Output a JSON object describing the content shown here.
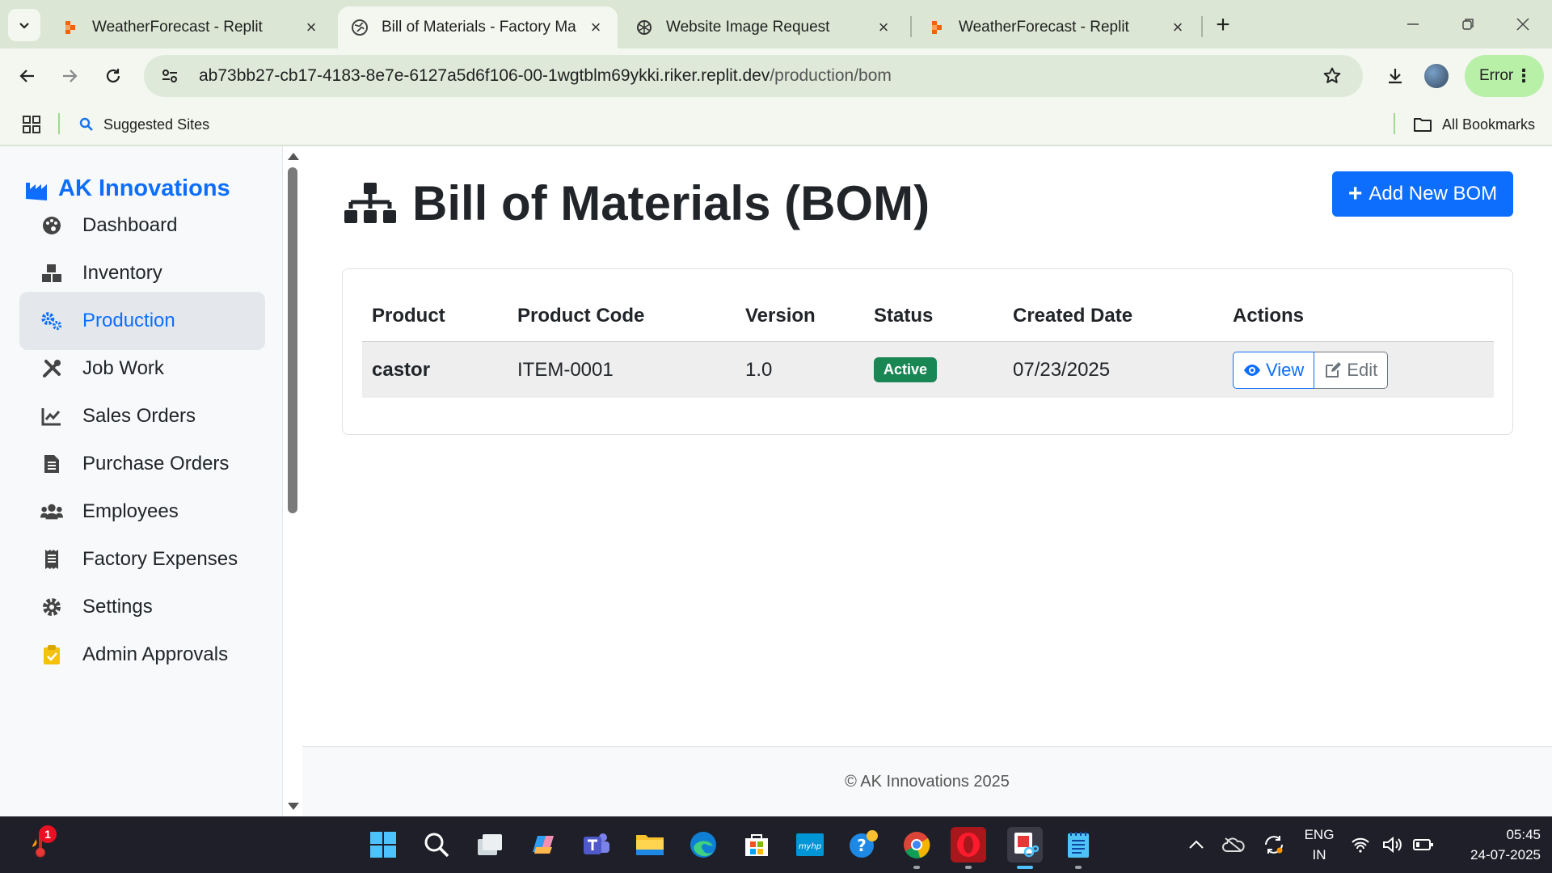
{
  "browser": {
    "tabs": [
      {
        "title": "WeatherForecast - Replit",
        "favicon": "replit-icon",
        "active": false
      },
      {
        "title": "Bill of Materials - Factory Mana",
        "favicon": "globe-icon",
        "active": true
      },
      {
        "title": "Website Image Request",
        "favicon": "chatgpt-icon",
        "active": false
      },
      {
        "title": "WeatherForecast - Replit",
        "favicon": "replit-icon",
        "active": false
      }
    ],
    "url_host": "ab73bb27-cb17-4183-8e7e-6127a5d6f106-00-1wgtblm69ykki.riker.replit.dev",
    "url_path": "/production/bom",
    "profile_status": "Error",
    "bookmarks": {
      "suggested": "Suggested Sites",
      "all": "All Bookmarks"
    }
  },
  "app": {
    "brand": "AK Innovations",
    "accent_color": "#0d6efd",
    "nav": [
      {
        "label": "Dashboard",
        "icon": "palette-icon",
        "active": false
      },
      {
        "label": "Inventory",
        "icon": "boxes-icon",
        "active": false
      },
      {
        "label": "Production",
        "icon": "cogs-icon",
        "active": true
      },
      {
        "label": "Job Work",
        "icon": "tools-icon",
        "active": false
      },
      {
        "label": "Sales Orders",
        "icon": "chart-line-icon",
        "active": false
      },
      {
        "label": "Purchase Orders",
        "icon": "file-invoice-icon",
        "active": false
      },
      {
        "label": "Employees",
        "icon": "users-icon",
        "active": false
      },
      {
        "label": "Factory Expenses",
        "icon": "receipt-icon",
        "active": false
      },
      {
        "label": "Settings",
        "icon": "gear-icon",
        "active": false
      },
      {
        "label": "Admin Approvals",
        "icon": "clipboard-check-icon",
        "active": false
      }
    ],
    "page_title": "Bill of Materials (BOM)",
    "add_button": "Add New BOM",
    "table": {
      "headers": [
        "Product",
        "Product Code",
        "Version",
        "Status",
        "Created Date",
        "Actions"
      ],
      "rows": [
        {
          "product": "castor",
          "code": "ITEM-0001",
          "version": "1.0",
          "status": "Active",
          "created": "07/23/2025",
          "view": "View",
          "edit": "Edit"
        }
      ]
    },
    "footer": "© AK Innovations 2025"
  },
  "taskbar": {
    "notification_count": "1",
    "language": "ENG",
    "region": "IN",
    "time": "05:45",
    "date": "24-07-2025"
  }
}
